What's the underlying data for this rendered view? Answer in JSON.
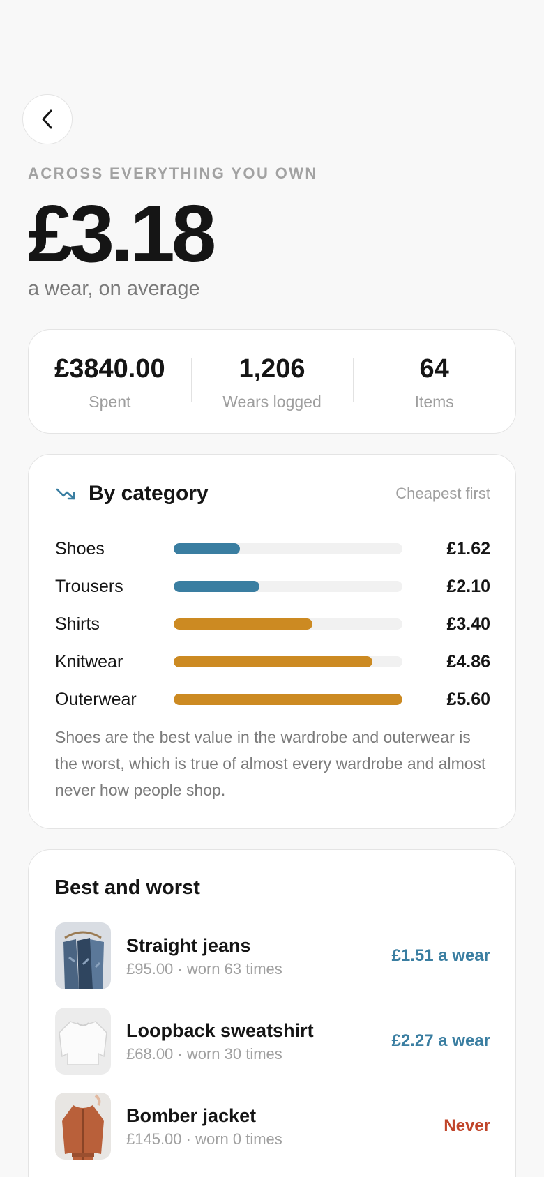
{
  "header": {
    "eyebrow": "ACROSS EVERYTHING YOU OWN",
    "average_price": "£3.18",
    "subtitle": "a wear, on average"
  },
  "stats": [
    {
      "value": "£3840.00",
      "label": "Spent"
    },
    {
      "value": "1,206",
      "label": "Wears logged"
    },
    {
      "value": "64",
      "label": "Items"
    }
  ],
  "category": {
    "title": "By category",
    "sort_label": "Cheapest first",
    "icon": "trending-down-icon",
    "rows": [
      {
        "label": "Shoes",
        "value": "£1.62",
        "fill": 0.29,
        "color": "#3a7ea1"
      },
      {
        "label": "Trousers",
        "value": "£2.10",
        "fill": 0.375,
        "color": "#3a7ea1"
      },
      {
        "label": "Shirts",
        "value": "£3.40",
        "fill": 0.607,
        "color": "#cc8a22"
      },
      {
        "label": "Knitwear",
        "value": "£4.86",
        "fill": 0.868,
        "color": "#cc8a22"
      },
      {
        "label": "Outerwear",
        "value": "£5.60",
        "fill": 1.0,
        "color": "#cc8a22"
      }
    ],
    "note": "Shoes are the best value in the wardrobe and outerwear is the worst, which is true of almost every wardrobe and almost never how people shop."
  },
  "best_worst": {
    "title": "Best and worst",
    "items": [
      {
        "name": "Straight jeans",
        "meta": "£95.00 · worn 63 times",
        "cpw": "£1.51 a wear",
        "cpw_color": "#3a7ea1"
      },
      {
        "name": "Loopback sweatshirt",
        "meta": "£68.00 · worn 30 times",
        "cpw": "£2.27 a wear",
        "cpw_color": "#3a7ea1"
      },
      {
        "name": "Bomber jacket",
        "meta": "£145.00 · worn 0 times",
        "cpw": "Never",
        "cpw_color": "#c0452a"
      }
    ]
  }
}
